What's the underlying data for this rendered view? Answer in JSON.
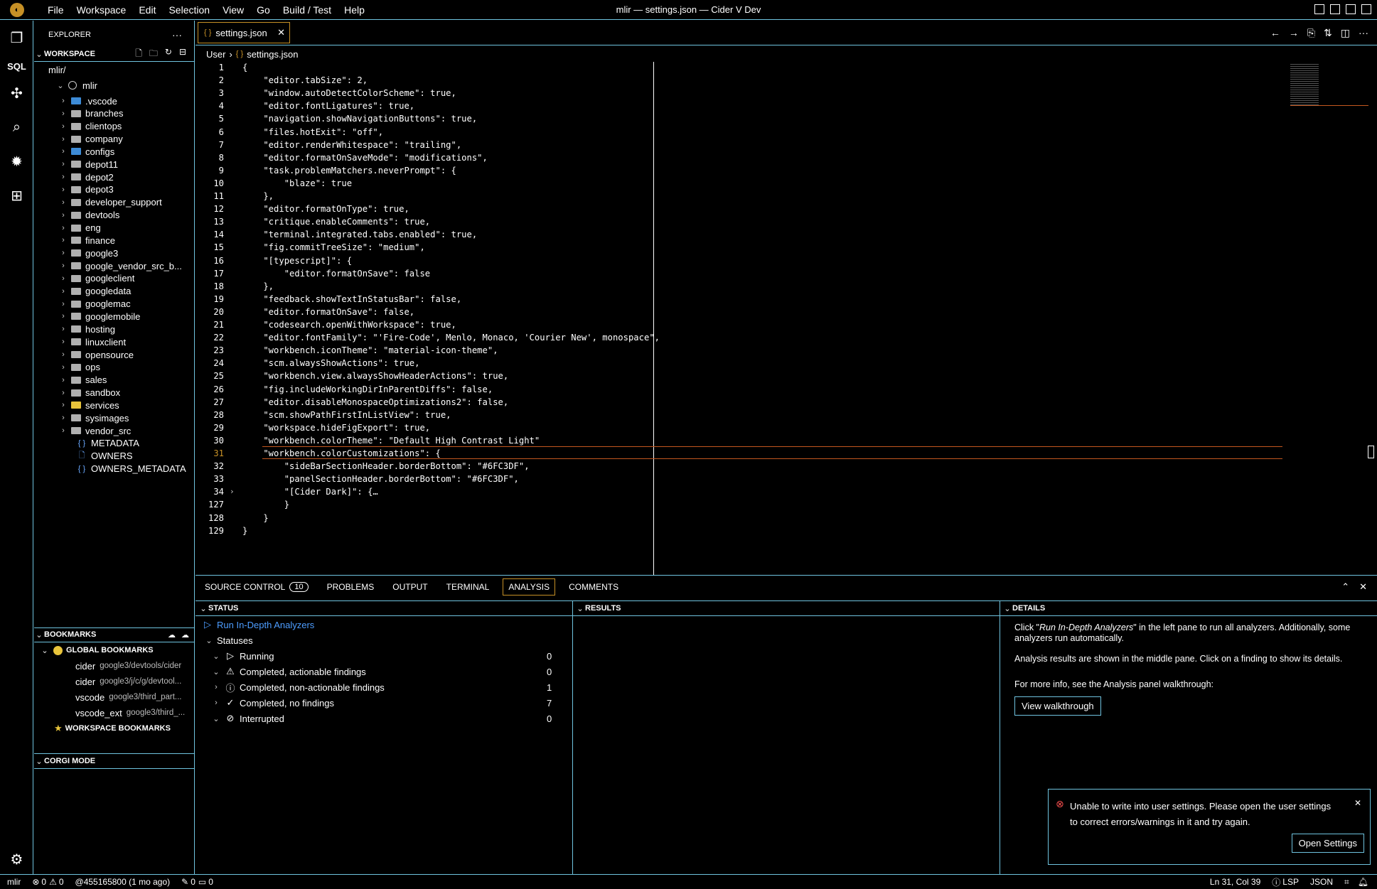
{
  "titlebar": {
    "menus": [
      "File",
      "Workspace",
      "Edit",
      "Selection",
      "View",
      "Go",
      "Build / Test",
      "Help"
    ],
    "title": "mlir — settings.json — Cider V Dev"
  },
  "activity": [
    "files-icon",
    "sql-icon",
    "source-graph-icon",
    "search-icon",
    "debug-icon",
    "extensions-icon"
  ],
  "activity_sql_label": "SQL",
  "explorer": {
    "title": "EXPLORER",
    "section": "WORKSPACE",
    "root": "mlir/",
    "project": "mlir",
    "folders": [
      ".vscode",
      "branches",
      "clientops",
      "company",
      "configs",
      "depot11",
      "depot2",
      "depot3",
      "developer_support",
      "devtools",
      "eng",
      "finance",
      "google3",
      "google_vendor_src_b...",
      "googleclient",
      "googledata",
      "googlemac",
      "googlemobile",
      "hosting",
      "linuxclient",
      "opensource",
      "ops",
      "sales",
      "sandbox",
      "services",
      "sysimages",
      "vendor_src"
    ],
    "files": [
      "METADATA",
      "OWNERS",
      "OWNERS_METADATA"
    ]
  },
  "bookmarks": {
    "title": "BOOKMARKS",
    "global": "GLOBAL BOOKMARKS",
    "items": [
      {
        "name": "cider",
        "path": "google3/devtools/cider"
      },
      {
        "name": "cider",
        "path": "google3/j/c/g/devtool..."
      },
      {
        "name": "vscode",
        "path": "google3/third_part..."
      },
      {
        "name": "vscode_ext",
        "path": "google3/third_..."
      }
    ],
    "workspace": "WORKSPACE BOOKMARKS"
  },
  "corgi": {
    "title": "CORGI MODE"
  },
  "editor": {
    "tab": "settings.json",
    "breadcrumb": [
      "User",
      "settings.json"
    ],
    "lines": [
      {
        "n": "1",
        "t": "{"
      },
      {
        "n": "2",
        "t": "    \"editor.tabSize\": 2,"
      },
      {
        "n": "3",
        "t": "    \"window.autoDetectColorScheme\": true,"
      },
      {
        "n": "4",
        "t": "    \"editor.fontLigatures\": true,"
      },
      {
        "n": "5",
        "t": "    \"navigation.showNavigationButtons\": true,"
      },
      {
        "n": "6",
        "t": "    \"files.hotExit\": \"off\","
      },
      {
        "n": "7",
        "t": "    \"editor.renderWhitespace\": \"trailing\","
      },
      {
        "n": "8",
        "t": "    \"editor.formatOnSaveMode\": \"modifications\","
      },
      {
        "n": "9",
        "t": "    \"task.problemMatchers.neverPrompt\": {"
      },
      {
        "n": "10",
        "t": "        \"blaze\": true"
      },
      {
        "n": "11",
        "t": "    },"
      },
      {
        "n": "12",
        "t": "    \"editor.formatOnType\": true,"
      },
      {
        "n": "13",
        "t": "    \"critique.enableComments\": true,"
      },
      {
        "n": "14",
        "t": "    \"terminal.integrated.tabs.enabled\": true,"
      },
      {
        "n": "15",
        "t": "    \"fig.commitTreeSize\": \"medium\","
      },
      {
        "n": "16",
        "t": "    \"[typescript]\": {"
      },
      {
        "n": "17",
        "t": "        \"editor.formatOnSave\": false"
      },
      {
        "n": "18",
        "t": "    },"
      },
      {
        "n": "19",
        "t": "    \"feedback.showTextInStatusBar\": false,"
      },
      {
        "n": "20",
        "t": "    \"editor.formatOnSave\": false,"
      },
      {
        "n": "21",
        "t": "    \"codesearch.openWithWorkspace\": true,"
      },
      {
        "n": "22",
        "t": "    \"editor.fontFamily\": \"'Fire-Code', Menlo, Monaco, 'Courier New', monospace\","
      },
      {
        "n": "23",
        "t": "    \"workbench.iconTheme\": \"material-icon-theme\","
      },
      {
        "n": "24",
        "t": "    \"scm.alwaysShowActions\": true,"
      },
      {
        "n": "25",
        "t": "    \"workbench.view.alwaysShowHeaderActions\": true,"
      },
      {
        "n": "26",
        "t": "    \"fig.includeWorkingDirInParentDiffs\": false,"
      },
      {
        "n": "27",
        "t": "    \"editor.disableMonospaceOptimizations2\": false,"
      },
      {
        "n": "28",
        "t": "    \"scm.showPathFirstInListView\": true,"
      },
      {
        "n": "29",
        "t": "    \"workspace.hideFigExport\": true,"
      },
      {
        "n": "30",
        "t": "    \"workbench.colorTheme\": \"Default High Contrast Light\""
      },
      {
        "n": "31",
        "t": "    \"workbench.colorCustomizations\": {"
      },
      {
        "n": "32",
        "t": "        \"sideBarSectionHeader.borderBottom\": \"#6FC3DF\","
      },
      {
        "n": "33",
        "t": "        \"panelSectionHeader.borderBottom\": \"#6FC3DF\","
      },
      {
        "n": "34",
        "t": "        \"[Cider Dark]\": {…"
      },
      {
        "n": "127",
        "t": "        }"
      },
      {
        "n": "128",
        "t": "    }"
      },
      {
        "n": "129",
        "t": "}"
      }
    ]
  },
  "panel": {
    "tabs": [
      {
        "label": "SOURCE CONTROL",
        "badge": "10"
      },
      {
        "label": "PROBLEMS"
      },
      {
        "label": "OUTPUT"
      },
      {
        "label": "TERMINAL"
      },
      {
        "label": "ANALYSIS",
        "active": true
      },
      {
        "label": "COMMENTS"
      }
    ],
    "status": {
      "title": "STATUS",
      "run_label": "Run In-Depth Analyzers",
      "statuses": "Statuses",
      "rows": [
        {
          "label": "Running",
          "count": "0",
          "icon": "play-icon"
        },
        {
          "label": "Completed, actionable findings",
          "count": "0",
          "icon": "warning-icon"
        },
        {
          "label": "Completed, non-actionable findings",
          "count": "1",
          "icon": "info-icon"
        },
        {
          "label": "Completed, no findings",
          "count": "7",
          "icon": "check-icon"
        },
        {
          "label": "Interrupted",
          "count": "0",
          "icon": "interrupted-icon"
        }
      ]
    },
    "results": {
      "title": "RESULTS"
    },
    "details": {
      "title": "DETAILS",
      "p1_a": "Click \"",
      "p1_em": "Run In-Depth Analyzers",
      "p1_b": "\" in the left pane to run all analyzers. Additionally, some analyzers run automatically.",
      "p2": "Analysis results are shown in the middle pane. Click on a finding to show its details.",
      "p3": "For more info, see the Analysis panel walkthrough:",
      "button": "View walkthrough"
    }
  },
  "toast": {
    "message": "Unable to write into user settings. Please open the user settings to correct errors/warnings in it and try again.",
    "button": "Open Settings"
  },
  "statusbar": {
    "workspace": "mlir",
    "errors": "0",
    "warnings": "0",
    "cl": "@455165800 (1 mo ago)",
    "edits": "0",
    "comments": "0",
    "position": "Ln 31, Col 39",
    "lsp": "LSP",
    "language": "JSON"
  },
  "colors": {
    "accent": "#6FC3DF",
    "tab_border": "#c69026",
    "current_line": "#c3571f",
    "link": "#4d9dff"
  }
}
